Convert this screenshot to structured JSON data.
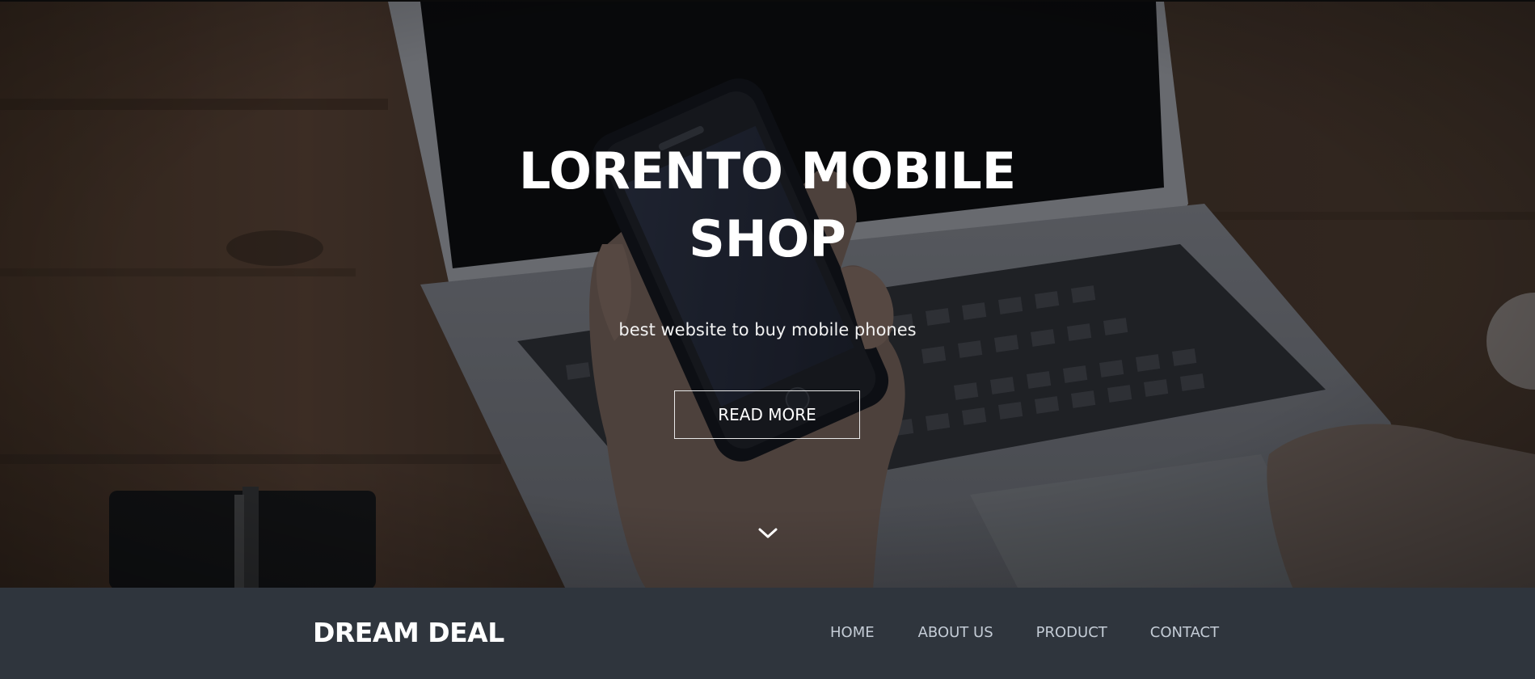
{
  "hero": {
    "title_line1": "LORENTO MOBILE",
    "title_line2": "SHOP",
    "subtitle": "best website to buy mobile phones",
    "cta_label": "READ MORE",
    "scroll_icon": "chevron-down-icon",
    "background_image": "hand-holding-smartphone-over-laptop-photo"
  },
  "navbar": {
    "brand": "DREAM DEAL",
    "links": [
      {
        "label": "HOME"
      },
      {
        "label": "ABOUT US"
      },
      {
        "label": "PRODUCT"
      },
      {
        "label": "CONTACT"
      }
    ]
  },
  "colors": {
    "navbar_bg": "#2f353d",
    "nav_link": "#c4ccd6",
    "hero_text": "#ffffff"
  }
}
